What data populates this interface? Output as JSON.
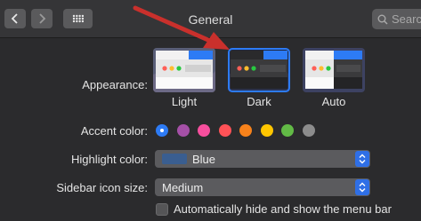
{
  "toolbar": {
    "title": "General",
    "search_placeholder": "Search",
    "back_icon": "chevron-left-icon",
    "forward_icon": "chevron-right-icon",
    "grid_icon": "grid-icon"
  },
  "appearance": {
    "label": "Appearance:",
    "options": [
      {
        "label": "Light",
        "selected": false
      },
      {
        "label": "Dark",
        "selected": true
      },
      {
        "label": "Auto",
        "selected": false
      }
    ]
  },
  "accent": {
    "label": "Accent color:",
    "colors": [
      "#2d7bf5",
      "#a550a7",
      "#f74f9e",
      "#ff5257",
      "#f7821b",
      "#ffc600",
      "#62ba46",
      "#8c8c8c"
    ],
    "selected_index": 0
  },
  "highlight": {
    "label": "Highlight color:",
    "value": "Blue"
  },
  "sidebar_icon": {
    "label": "Sidebar icon size:",
    "value": "Medium"
  },
  "menu_bar": {
    "label": "Automatically hide and show the menu bar",
    "checked": false
  },
  "colors": {
    "window_bg": "#2b2b2d",
    "accent_blue": "#2d7bf5",
    "annotation_arrow": "#c9302c"
  }
}
